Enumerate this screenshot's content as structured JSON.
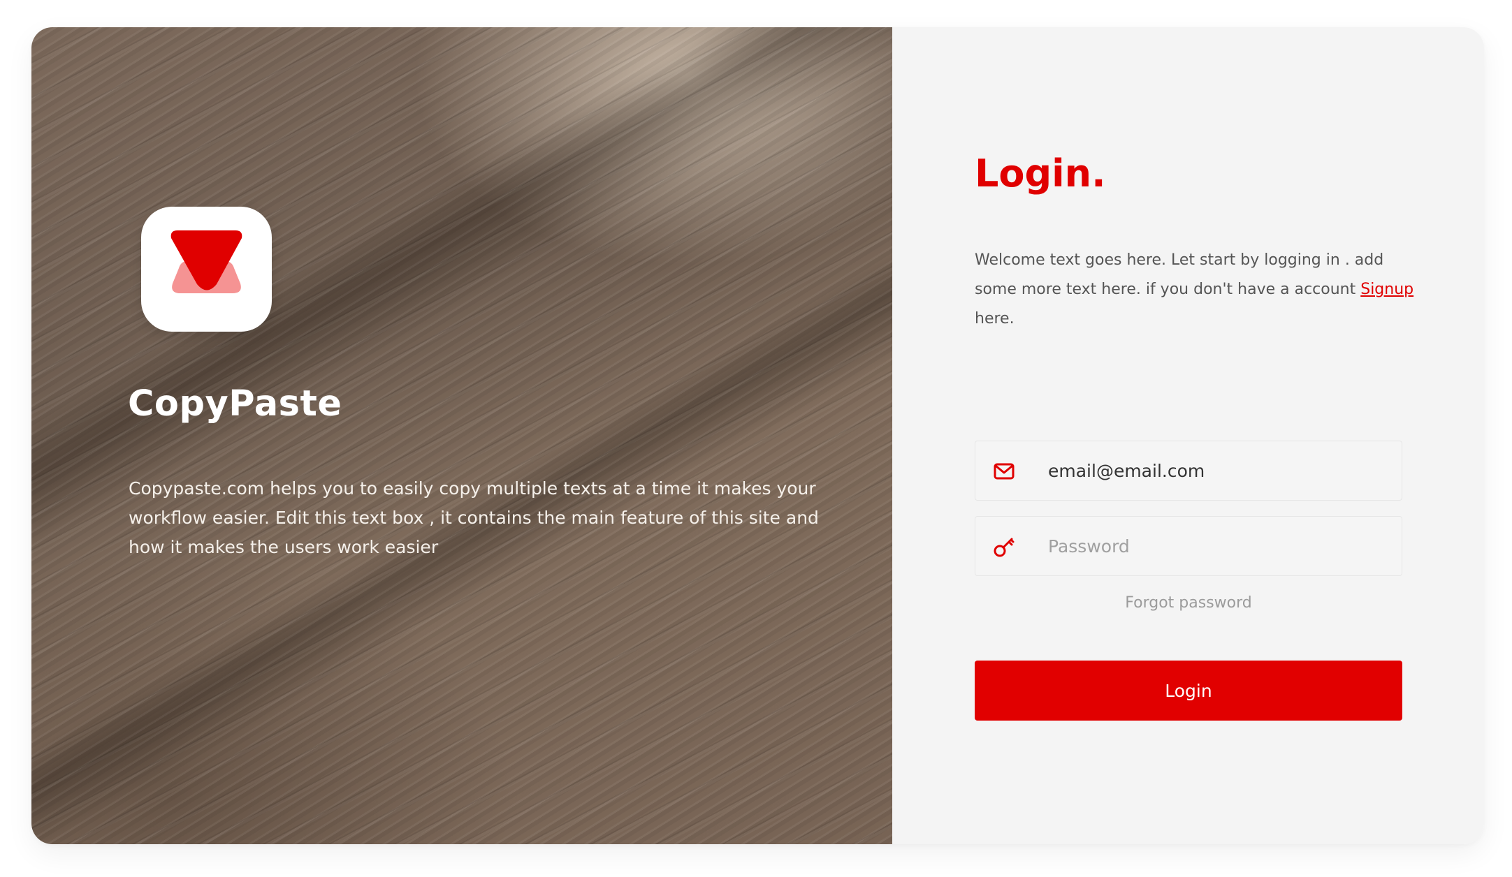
{
  "brand": {
    "name": "CopyPaste",
    "logo_icon": "copypaste-logo",
    "description": "Copypaste.com helps you to easily copy multiple texts at a time it makes your workflow easier. Edit this text box , it contains the main feature of this site and how it makes the users work easier"
  },
  "login": {
    "title": "Login.",
    "welcome_before": "Welcome text goes here. Let start by logging in . add some more text here. if you don't have a account ",
    "signup_label": "Signup",
    "welcome_after": " here.",
    "email": {
      "icon": "mail-icon",
      "value": "email@email.com"
    },
    "password": {
      "icon": "key-icon",
      "placeholder": "Password"
    },
    "forgot_label": "Forgot password",
    "button_label": "Login"
  },
  "colors": {
    "accent": "#e00000",
    "accent_light": "#f59393",
    "panel_bg": "#f4f4f4"
  }
}
